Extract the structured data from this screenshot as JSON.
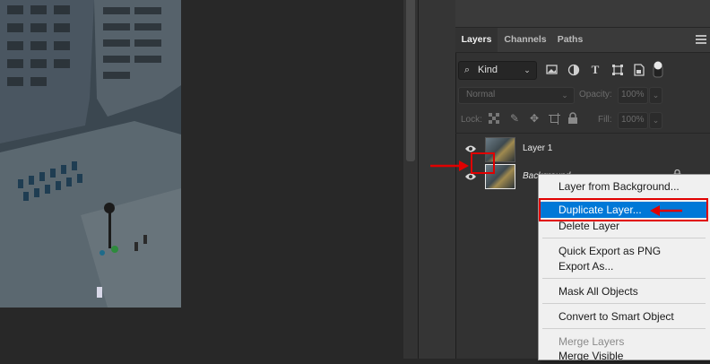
{
  "tabs": [
    {
      "label": "Layers",
      "active": true
    },
    {
      "label": "Channels",
      "active": false
    },
    {
      "label": "Paths",
      "active": false
    }
  ],
  "filter": {
    "label": "Kind"
  },
  "blend": {
    "mode": "Normal",
    "opacity_label": "Opacity:",
    "opacity_value": "100%"
  },
  "lock": {
    "label": "Lock:",
    "fill_label": "Fill:",
    "fill_value": "100%"
  },
  "layers": [
    {
      "name": "Layer 1",
      "visible": true
    },
    {
      "name": "Background",
      "visible": true,
      "locked": true
    }
  ],
  "context_menu": {
    "items": [
      {
        "label": "Layer from Background...",
        "enabled": true
      },
      {
        "label": "Duplicate Layer...",
        "enabled": true,
        "highlighted": true
      },
      {
        "label": "Delete Layer",
        "enabled": true
      },
      {
        "label": "Quick Export as PNG",
        "enabled": true
      },
      {
        "label": "Export As...",
        "enabled": true
      },
      {
        "label": "Mask All Objects",
        "enabled": true
      },
      {
        "label": "Convert to Smart Object",
        "enabled": true
      },
      {
        "label": "Merge Layers",
        "enabled": false
      },
      {
        "label": "Merge Visible",
        "enabled": true
      }
    ]
  },
  "colors": {
    "highlight": "#0078d7",
    "annotation": "#e00000",
    "panel_bg": "#323232"
  }
}
